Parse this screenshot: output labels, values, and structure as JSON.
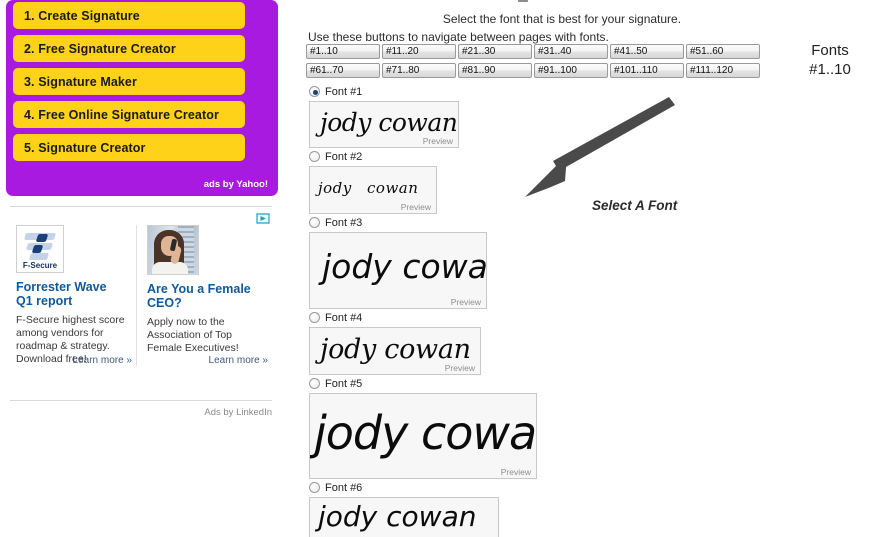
{
  "sidebar": {
    "yahoo_ad": {
      "items": [
        {
          "label": "1. Create Signature"
        },
        {
          "label": "2. Free Signature Creator"
        },
        {
          "label": "3. Signature Maker"
        },
        {
          "label": "4. Free Online Signature Creator"
        },
        {
          "label": "5. Signature Creator"
        }
      ],
      "attribution": "ads by Yahoo!",
      "background_color": "#a81ae0",
      "button_color": "#ffd21a"
    },
    "linkedin_ad": {
      "ad_choices_icon": "ad-choices-icon",
      "cards": [
        {
          "thumb_icon": "f-secure-logo-icon",
          "logo_text": "F-Secure",
          "title": "Forrester Wave Q1 report",
          "body": "F-Secure highest score among vendors for roadmap & strategy. Download free!",
          "cta": "Learn more »"
        },
        {
          "thumb_icon": "woman-on-phone-photo",
          "logo_text": "",
          "title": "Are You a Female CEO?",
          "body": "Apply now to the Association of Top Female Executives!",
          "cta": "Learn more »"
        }
      ],
      "attribution": "Ads by LinkedIn"
    }
  },
  "main": {
    "headline": "Select the font that is best for your signature.",
    "subline": "Use these buttons to navigate between pages with fonts.",
    "fonts_label_line1": "Fonts",
    "fonts_label_line2": "#1..10",
    "pager": {
      "row1": [
        "#1..10",
        "#11..20",
        "#21..30",
        "#31..40",
        "#41..50",
        "#51..60"
      ],
      "row2": [
        "#61..70",
        "#71..80",
        "#81..90",
        "#91..100",
        "#101..110",
        "#111..120"
      ]
    },
    "preview_tag": "Preview",
    "signature_text": "jody cowan",
    "fonts": [
      {
        "label": "Font #1",
        "selected": true
      },
      {
        "label": "Font #2",
        "selected": false
      },
      {
        "label": "Font #3",
        "selected": false
      },
      {
        "label": "Font #4",
        "selected": false
      },
      {
        "label": "Font #5",
        "selected": false
      },
      {
        "label": "Font #6",
        "selected": false
      }
    ],
    "annotation": {
      "text": "Select A Font",
      "arrow_color": "#4a4a4a"
    }
  }
}
